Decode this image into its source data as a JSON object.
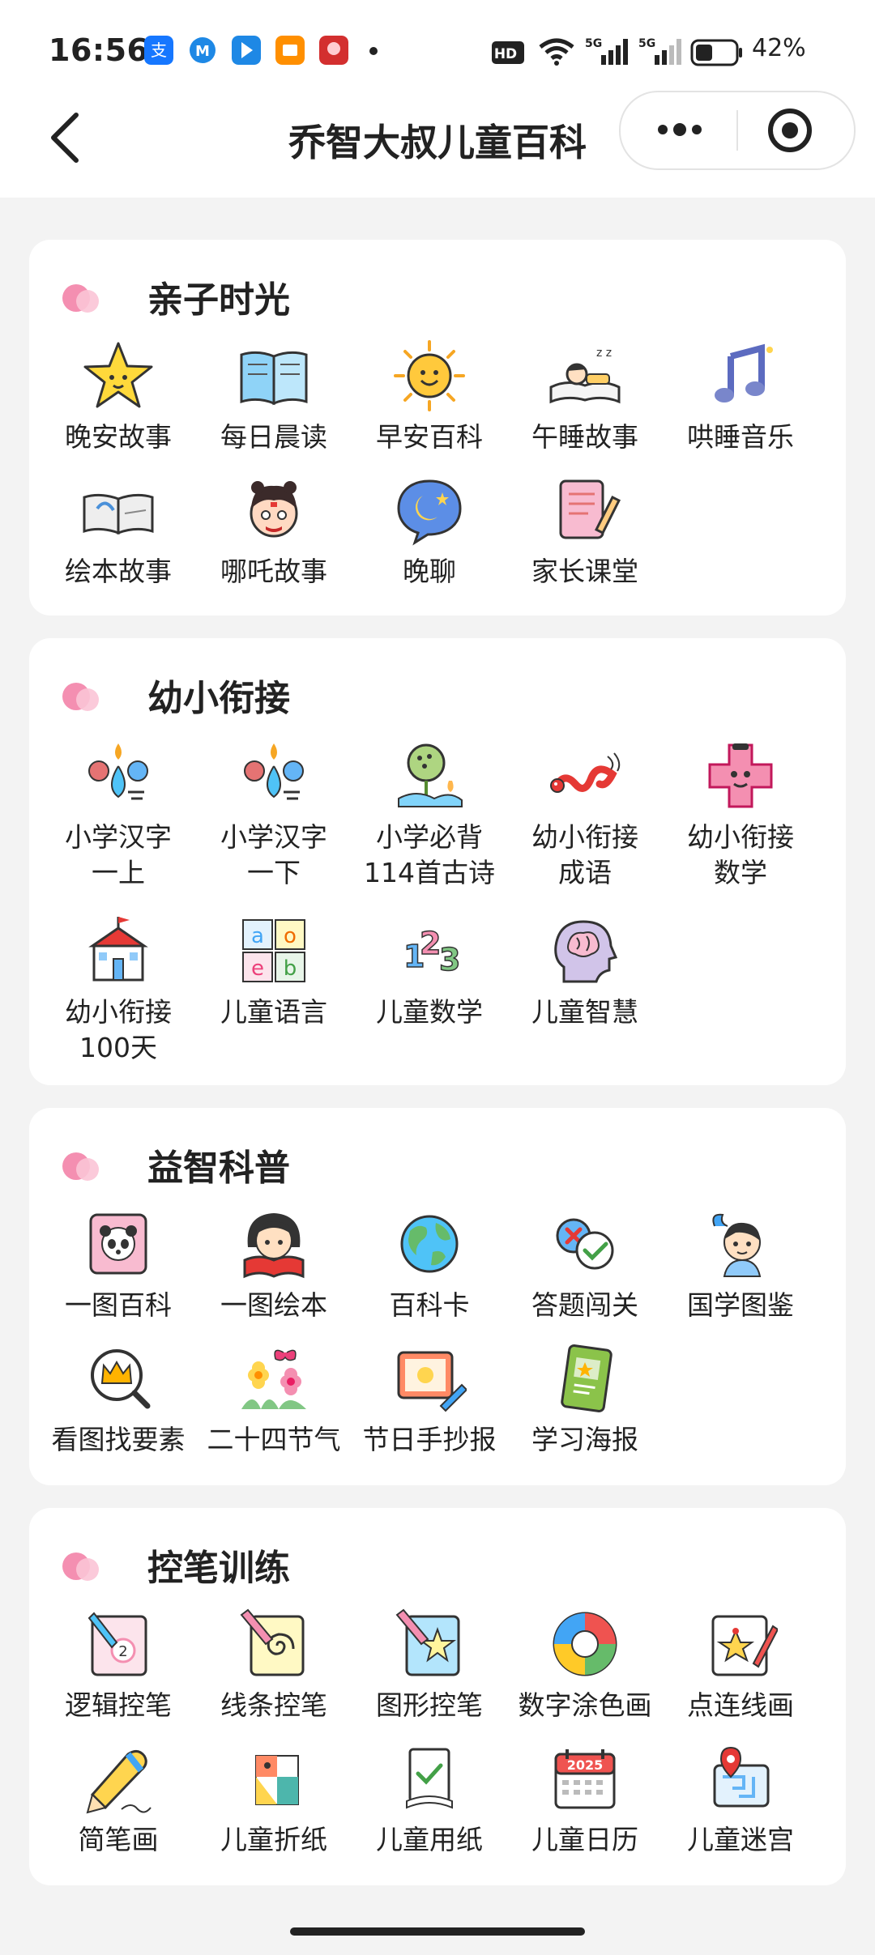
{
  "status": {
    "time": "16:56",
    "hd": "HD",
    "battery": "42%",
    "notif_icons": [
      "alipay-icon",
      "m-icon",
      "arrow-app-icon",
      "orange-app-icon",
      "red-app-icon"
    ]
  },
  "nav": {
    "title": "乔智大叔儿童百科"
  },
  "sections": [
    {
      "title": "亲子时光",
      "items": [
        {
          "label": "晚安故事",
          "icon": "star-icon"
        },
        {
          "label": "每日晨读",
          "icon": "open-book-icon"
        },
        {
          "label": "早安百科",
          "icon": "sun-icon"
        },
        {
          "label": "午睡故事",
          "icon": "sleeping-child-icon"
        },
        {
          "label": "哄睡音乐",
          "icon": "music-note-icon"
        },
        {
          "label": "绘本故事",
          "icon": "picture-book-icon"
        },
        {
          "label": "哪吒故事",
          "icon": "nezha-icon"
        },
        {
          "label": "晚聊",
          "icon": "moon-chat-icon"
        },
        {
          "label": "家长课堂",
          "icon": "notepad-pencil-icon"
        }
      ]
    },
    {
      "title": "幼小衔接",
      "items": [
        {
          "label": "小学汉字\n一上",
          "icon": "hanzi-upper-icon"
        },
        {
          "label": "小学汉字\n一下",
          "icon": "hanzi-lower-icon"
        },
        {
          "label": "小学必背\n114首古诗",
          "icon": "lotus-poem-icon"
        },
        {
          "label": "幼小衔接\n成语",
          "icon": "dragon-icon"
        },
        {
          "label": "幼小衔接\n数学",
          "icon": "plus-face-icon"
        },
        {
          "label": "幼小衔接\n100天",
          "icon": "school-icon"
        },
        {
          "label": "儿童语言",
          "icon": "letter-blocks-icon"
        },
        {
          "label": "儿童数学",
          "icon": "numbers-123-icon"
        },
        {
          "label": "儿童智慧",
          "icon": "brain-head-icon"
        }
      ]
    },
    {
      "title": "益智科普",
      "items": [
        {
          "label": "一图百科",
          "icon": "panda-card-icon"
        },
        {
          "label": "一图绘本",
          "icon": "girl-reading-icon"
        },
        {
          "label": "百科卡",
          "icon": "globe-icon"
        },
        {
          "label": "答题闯关",
          "icon": "quiz-bubbles-icon"
        },
        {
          "label": "国学图鉴",
          "icon": "ancient-child-icon"
        },
        {
          "label": "看图找要素",
          "icon": "crown-magnifier-icon"
        },
        {
          "label": "二十四节气",
          "icon": "flowers-butterfly-icon"
        },
        {
          "label": "节日手抄报",
          "icon": "paint-poster-icon"
        },
        {
          "label": "学习海报",
          "icon": "green-poster-icon"
        }
      ]
    },
    {
      "title": "控笔训练",
      "items": [
        {
          "label": "逻辑控笔",
          "icon": "logic-pen-icon"
        },
        {
          "label": "线条控笔",
          "icon": "spiral-pen-icon"
        },
        {
          "label": "图形控笔",
          "icon": "star-pen-icon"
        },
        {
          "label": "数字涂色画",
          "icon": "color-circle-icon"
        },
        {
          "label": "点连线画",
          "icon": "dot-star-icon"
        },
        {
          "label": "简笔画",
          "icon": "pencil-draw-icon"
        },
        {
          "label": "儿童折纸",
          "icon": "origami-icon"
        },
        {
          "label": "儿童用纸",
          "icon": "paper-check-icon"
        },
        {
          "label": "儿童日历",
          "icon": "calendar-2025-icon"
        },
        {
          "label": "儿童迷宫",
          "icon": "maze-map-icon"
        }
      ]
    }
  ],
  "calendar_year": "2025",
  "colors": {
    "accent_pink": "#f48fb1",
    "background": "#f3f3f3",
    "card": "#ffffff"
  }
}
